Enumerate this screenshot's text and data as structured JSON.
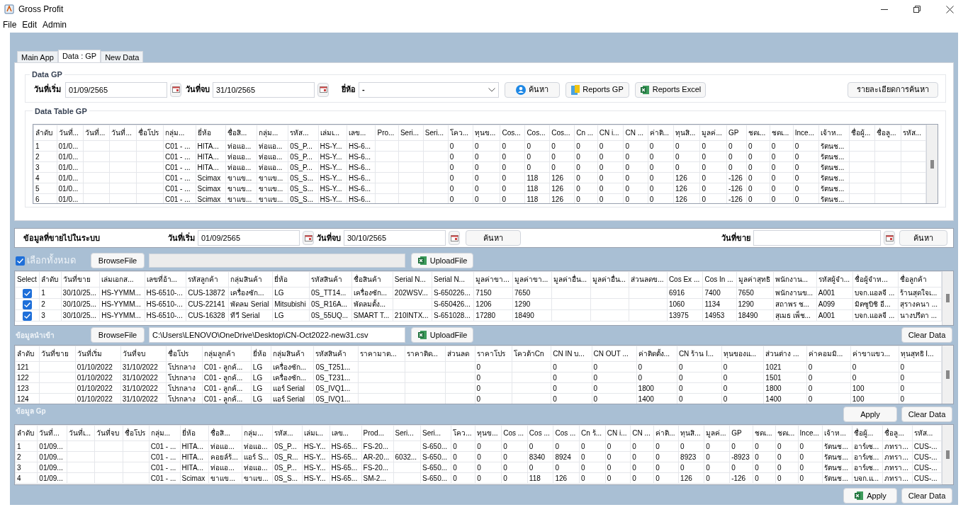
{
  "window": {
    "title": "Gross Profit"
  },
  "menu": [
    "File",
    "Edit",
    "Admin"
  ],
  "tabs": [
    {
      "label": "Main App",
      "selected": false
    },
    {
      "label": "Data : GP",
      "selected": true
    },
    {
      "label": "New Data",
      "selected": false
    }
  ],
  "data_gp": {
    "title": "Data GP",
    "start_label": "วันที่เริ่ม",
    "start_value": "01/09/2565",
    "end_label": "วันที่จบ",
    "end_value": "31/10/2565",
    "brand_label": "ยี่ห้อ",
    "brand_value": "-",
    "search_button": "ค้นหา",
    "report_button": "Reports GP",
    "excel_button": "Reports Excel",
    "detail_button": "รายละเอียดการค้นหา"
  },
  "gp_table": {
    "title": "Data Table GP",
    "columns": [
      "ลำดับ",
      "วันที่...",
      "วันที่...",
      "วันที่...",
      "ชื่อโปร",
      "กลุ่ม...",
      "ยี่ห้อ",
      "ชื่อสิ...",
      "กลุ่ม...",
      "รหัส...",
      "เล่มเ...",
      "เลข...",
      "Pro...",
      "Seri...",
      "Seri...",
      "โคว...",
      "ทุนข...",
      "Cos...",
      "Cos...",
      "Cos...",
      "Cn ...",
      "CN i...",
      "CN ...",
      "ค่าติ...",
      "ทุนสิ...",
      "มูลค่...",
      "GP",
      "ชดเ...",
      "ชดเ...",
      "Ince...",
      "เจ้าห...",
      "ชื่อผู้...",
      "ชื่อลู...",
      "รหัส..."
    ],
    "rows": [
      [
        "1",
        "01/0...",
        null,
        null,
        null,
        "C01 - ...",
        "HITA...",
        "ท่อแอ...",
        "ท่อแอ...",
        "0S_P...",
        "HS-Y...",
        "HS-6...",
        null,
        null,
        null,
        "0",
        "0",
        "0",
        "0",
        "0",
        "0",
        "0",
        "0",
        "0",
        "0",
        "0",
        "0",
        "0",
        "0",
        "0",
        "รัตนช...",
        null,
        null,
        null
      ],
      [
        "2",
        "01/0...",
        null,
        null,
        null,
        "C01 - ...",
        "HITA...",
        "ท่อแอ...",
        "ท่อแอ...",
        "0S_P...",
        "HS-Y...",
        "HS-6...",
        null,
        null,
        null,
        "0",
        "0",
        "0",
        "0",
        "0",
        "0",
        "0",
        "0",
        "0",
        "0",
        "0",
        "0",
        "0",
        "0",
        "0",
        "รัตนช...",
        null,
        null,
        null
      ],
      [
        "3",
        "01/0...",
        null,
        null,
        null,
        "C01 - ...",
        "HITA...",
        "ท่อแอ...",
        "ท่อแอ...",
        "0S_P...",
        "HS-Y...",
        "HS-6...",
        null,
        null,
        null,
        "0",
        "0",
        "0",
        "0",
        "0",
        "0",
        "0",
        "0",
        "0",
        "0",
        "0",
        "0",
        "0",
        "0",
        "0",
        "รัตนช...",
        null,
        null,
        null
      ],
      [
        "4",
        "01/0...",
        null,
        null,
        null,
        "C01 - ...",
        "Scimax",
        "ขาแข...",
        "ขาแข...",
        "0S_S...",
        "HS-Y...",
        "HS-6...",
        null,
        null,
        null,
        "0",
        "0",
        "0",
        "118",
        "126",
        "0",
        "0",
        "0",
        "0",
        "126",
        "0",
        "-126",
        "0",
        "0",
        "0",
        "รัตนช...",
        null,
        null,
        null
      ],
      [
        "5",
        "01/0...",
        null,
        null,
        null,
        "C01 - ...",
        "Scimax",
        "ขาแข...",
        "ขาแข...",
        "0S_S...",
        "HS-Y...",
        "HS-6...",
        null,
        null,
        null,
        "0",
        "0",
        "0",
        "118",
        "126",
        "0",
        "0",
        "0",
        "0",
        "126",
        "0",
        "-126",
        "0",
        "0",
        "0",
        "รัตนช...",
        null,
        null,
        null
      ],
      [
        "6",
        "01/0...",
        null,
        null,
        null,
        "C01 - ...",
        "Scimax",
        "ขาแข...",
        "ขาแข...",
        "0S_S...",
        "HS-Y...",
        "HS-6...",
        null,
        null,
        null,
        "0",
        "0",
        "0",
        "118",
        "126",
        "0",
        "0",
        "0",
        "0",
        "126",
        "0",
        "-126",
        "0",
        "0",
        "0",
        "รัตนช...",
        null,
        null,
        null
      ]
    ]
  },
  "sold": {
    "title": "ข้อมูลที่ขายไปในระบบ",
    "start_label": "วันที่เริ่ม",
    "start_value": "01/09/2565",
    "end_label": "วันที่จบ",
    "end_value": "30/10/2565",
    "search_button": "ค้นหา",
    "sale_date_label": "วันที่ขาย",
    "sale_search_button": "ค้นหา"
  },
  "select_all": {
    "label": "เลือกทั้งหมด",
    "checked": true
  },
  "sold_upload": {
    "browse_button": "BrowseFile",
    "upload_button": "UploadFile"
  },
  "sold_table": {
    "columns": [
      "Select",
      "ลำดับ",
      "วันที่ขาย",
      "เล่มเอกส...",
      "เลขที่อ้า...",
      "รหัสลูกค้า",
      "กลุ่มสินค้า",
      "ยี่ห้อ",
      "รหัสสินค้า",
      "ชื่อสินค้า",
      "Serial N...",
      "Serial N...",
      "มูลค่าขา...",
      "มูลค่าขา...",
      "มูลค่าอื่น...",
      "มูลค่าอื่น...",
      "ส่วนลดข...",
      "Cos Ex ...",
      "Cos In ...",
      "มูลค่าสุทธิ",
      "พนักงาน...",
      "รหัสผู้จำ...",
      "ชื่อผู้จำห...",
      "ชื่อลูกค้า"
    ],
    "rows": [
      {
        "checked": true,
        "cells": [
          null,
          "1",
          "30/10/25...",
          "HS-YYMM...",
          "HS-6510-...",
          "CUS-13872",
          "เครื่องซัก...",
          "LG",
          "0S_TT14...",
          "เครื่องซัก...",
          "202WSV...",
          "S-650226...",
          "7150",
          "7650",
          null,
          null,
          null,
          "6916",
          "7400",
          "7650",
          "พนักงานข...",
          "A001",
          "บจก.แอลจี ...",
          "ร้านสุดใจเ..."
        ]
      },
      {
        "checked": true,
        "cells": [
          null,
          "2",
          "30/10/25...",
          "HS-YYMM...",
          "HS-6510-...",
          "CUS-22141",
          "พัดลม Serial",
          "Mitsubishi",
          "0S_R16A...",
          "พัดลมตั้ง...",
          null,
          "S-650426...",
          "1206",
          "1290",
          null,
          null,
          null,
          "1060",
          "1134",
          "1290",
          "สถาพร ช...",
          "A099",
          "มิตซูบิชิ อี...",
          "สุรางคนา ..."
        ]
      },
      {
        "checked": true,
        "cells": [
          null,
          "3",
          "30/10/25...",
          "HS-YYMM...",
          "HS-6510-...",
          "CUS-16328",
          "ทีวี Serial",
          "LG",
          "0S_55UQ...",
          "SMART T...",
          "210INTX...",
          "S-651028...",
          "17280",
          "18490",
          null,
          null,
          null,
          "13975",
          "14953",
          "18490",
          "สุเมธ เพ็ช...",
          "A001",
          "บจก.แอลจี ...",
          "นางปรีดา ..."
        ]
      }
    ]
  },
  "import": {
    "title": "ข้อมูลนำเข้า",
    "browse_button": "BrowseFile",
    "path": "C:\\Users\\LENOVO\\OneDrive\\Desktop\\CN-Oct2022-new31.csv",
    "upload_button": "UploadFile",
    "clear_button": "Clear Data"
  },
  "import_table": {
    "columns": [
      "ลำดับ",
      "วันที่ขาย",
      "วันที่เริ่ม",
      "วันที่จบ",
      "ชื่อโปร",
      "กลุ่มลูกค้า",
      "ยี่ห้อ",
      "กลุ่มสินค้า",
      "รหัสสินค้า",
      "ราคามาต...",
      "ราคาติด...",
      "ส่วนลด",
      "ราคาโปร",
      "โควต้าCn",
      "CN IN บ...",
      "CN OUT ...",
      "ค่าติดตั้ง...",
      "CN ร้าน I...",
      "ทุนของแ...",
      "ส่วนต่าง ...",
      "ค่าคอมมิ...",
      "ค่าขาแขว...",
      "ทุนสุทธิ I..."
    ],
    "rows": [
      [
        "121",
        null,
        "01/10/2022",
        "31/10/2022",
        "โปรกลาง",
        "C01 - ลูกค้...",
        "LG",
        "เครื่องซัก...",
        "0S_T251...",
        null,
        null,
        null,
        "0",
        null,
        "0",
        "0",
        "0",
        "0",
        "0",
        "1021",
        "0",
        "0",
        "0"
      ],
      [
        "122",
        null,
        "01/10/2022",
        "31/10/2022",
        "โปรกลาง",
        "C01 - ลูกค้...",
        "LG",
        "เครื่องซัก...",
        "0S_T231...",
        null,
        null,
        null,
        "0",
        null,
        "0",
        "0",
        "0",
        "0",
        "0",
        "1501",
        "0",
        "0",
        "0"
      ],
      [
        "123",
        null,
        "01/10/2022",
        "31/10/2022",
        "โปรกลาง",
        "C01 - ลูกค้...",
        "LG",
        "แอร์ Serial",
        "0S_IVQ1...",
        null,
        null,
        null,
        "0",
        null,
        "0",
        "0",
        "1800",
        "0",
        "0",
        "1800",
        "0",
        "100",
        "0"
      ],
      [
        "124",
        null,
        "01/10/2022",
        "31/10/2022",
        "โปรกลาง",
        "C01 - ลูกค้...",
        "LG",
        "แอร์ Serial",
        "0S_IVQ1...",
        null,
        null,
        null,
        "0",
        null,
        "0",
        "0",
        "1400",
        "0",
        "0",
        "1400",
        "0",
        "100",
        "0"
      ]
    ]
  },
  "gp": {
    "title": "ข้อมูล Gp",
    "apply_button": "Apply",
    "clear_button": "Clear Data"
  },
  "gp_result_table": {
    "columns": [
      "ลำดับ",
      "วันที่...",
      "วันที่เ...",
      "วันที่จบ",
      "ชื่อโปร",
      "กลุ่ม...",
      "ยี่ห้อ",
      "ชื่อสิ...",
      "กลุ่ม...",
      "รหัส...",
      "เล่มเ...",
      "เลข...",
      "Prod...",
      "Seri...",
      "Seri...",
      "โคว...",
      "ทุนข...",
      "Cos ...",
      "Cos ...",
      "Cos ...",
      "Cn ร้...",
      "CN i...",
      "CN ...",
      "ค่าติ...",
      "ทุนสิ...",
      "มูลค่...",
      "GP",
      "ชดเ...",
      "ชดเ...",
      "Ince...",
      "เจ้าห...",
      "ชื่อผู้...",
      "ชื่อลู...",
      "รหัส..."
    ],
    "rows": [
      [
        "1",
        "01/09...",
        null,
        null,
        null,
        "C01 - ...",
        "HITA...",
        "ท่อแอ...",
        "ท่อแอ...",
        "0S_P...",
        "HS-Y...",
        "HS-65...",
        "FS-20...",
        null,
        "S-650...",
        "0",
        "0",
        "0",
        "0",
        "0",
        "0",
        "0",
        "0",
        "0",
        "0",
        "0",
        "0",
        "0",
        "0",
        "0",
        "รัตนช...",
        "อาร์เซ...",
        "ภทรา...",
        "CUS-..."
      ],
      [
        "2",
        "01/09...",
        null,
        null,
        null,
        "C01 - ...",
        "HITA...",
        "คอยล์ร้...",
        "แอร์ S...",
        "0S_R...",
        "HS-Y...",
        "HS-65...",
        "AR-20...",
        "6032...",
        "S-650...",
        "0",
        "0",
        "0",
        "8340",
        "8924",
        "0",
        "0",
        "0",
        "0",
        "8923",
        "0",
        "-8923",
        "0",
        "0",
        "0",
        "รัตนช...",
        "อาร์เซ...",
        "ภทรา...",
        "CUS-..."
      ],
      [
        "3",
        "01/09...",
        null,
        null,
        null,
        "C01 - ...",
        "HITA...",
        "ท่อแอ...",
        "ท่อแอ...",
        "0S_P...",
        "HS-Y...",
        "HS-65...",
        "FS-20...",
        null,
        "S-650...",
        "0",
        "0",
        "0",
        "0",
        "0",
        "0",
        "0",
        "0",
        "0",
        "0",
        "0",
        "0",
        "0",
        "0",
        "0",
        "รัตนช...",
        "อาร์เซ...",
        "ภทรา...",
        "CUS-..."
      ],
      [
        "4",
        "01/09...",
        null,
        null,
        null,
        "C01 - ...",
        "Scimax",
        "ขาแข...",
        "ขาแข...",
        "0S_S...",
        "HS-Y...",
        "HS-65...",
        "SM-2...",
        null,
        "S-650...",
        "0",
        "0",
        "0",
        "118",
        "126",
        "0",
        "0",
        "0",
        "0",
        "126",
        "0",
        "-126",
        "0",
        "0",
        "0",
        "รัตนช...",
        "บจก.แ...",
        "ภทรา...",
        "CUS-..."
      ]
    ]
  },
  "bottom": {
    "apply_button": "Apply",
    "clear_button": "Clear Data"
  }
}
